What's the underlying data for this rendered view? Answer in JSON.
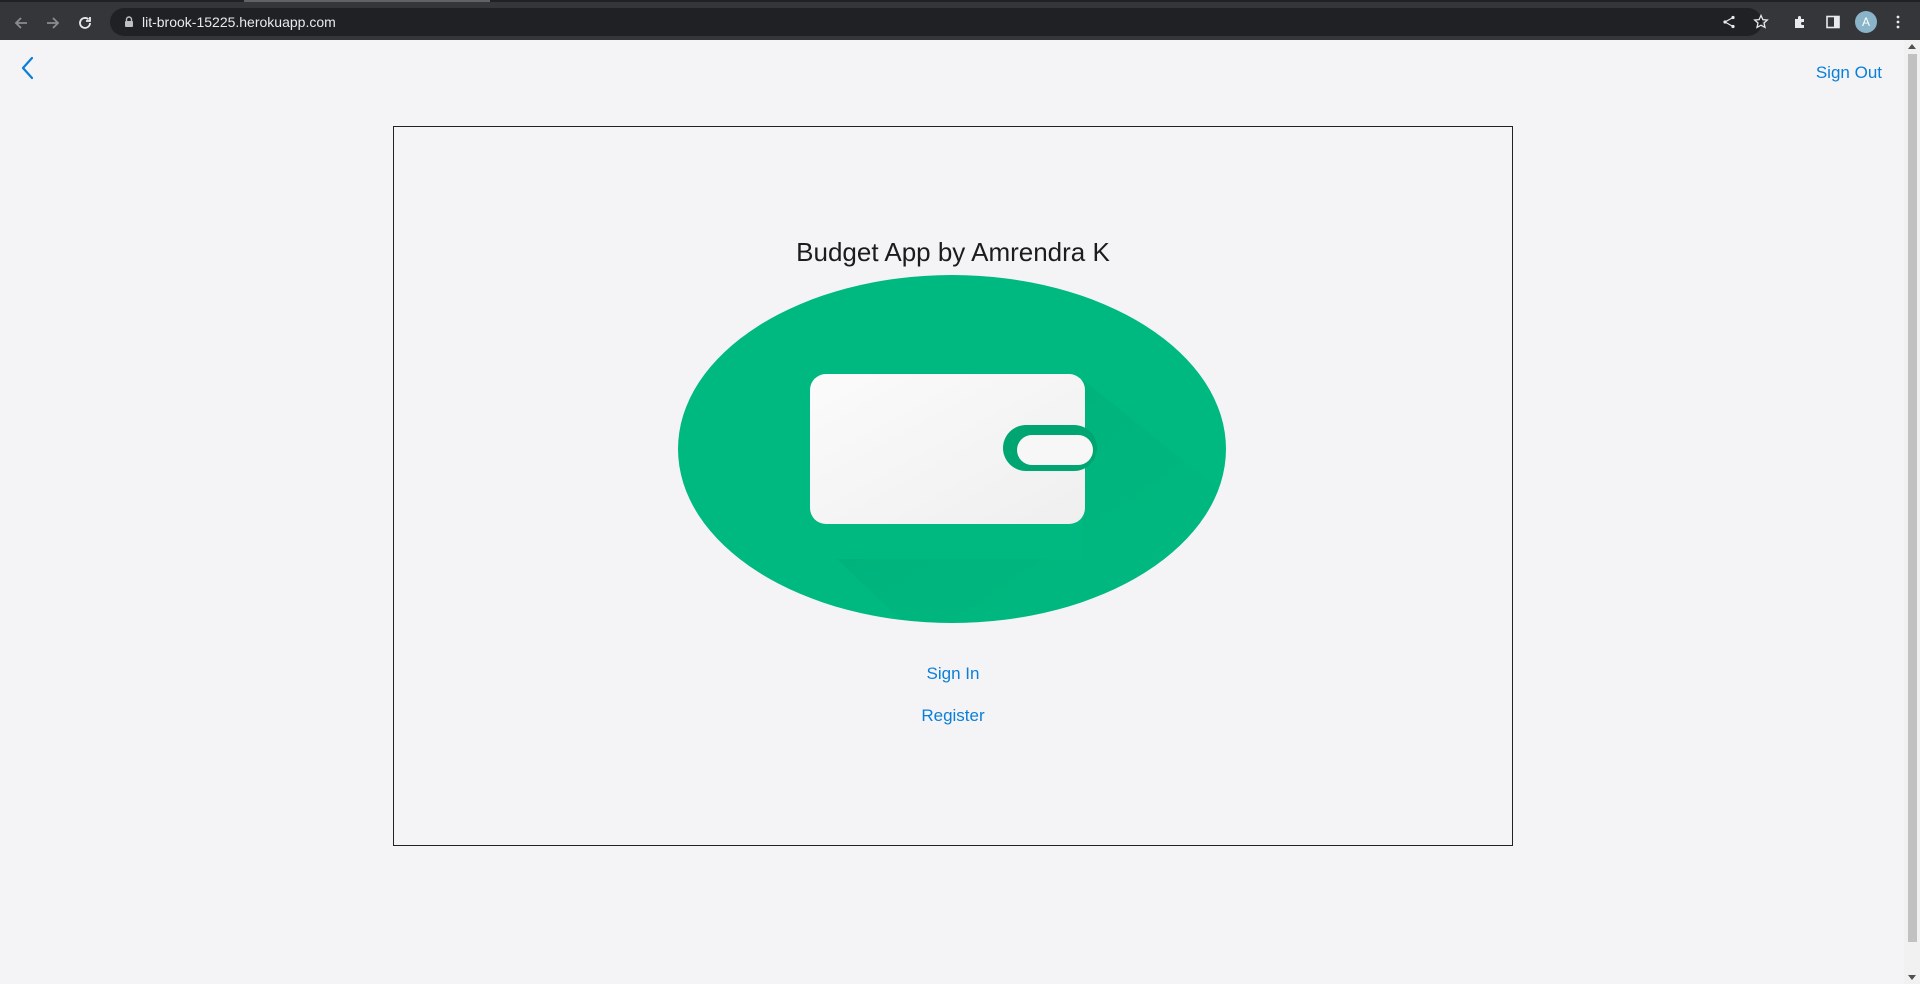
{
  "browser": {
    "url": "lit-brook-15225.herokuapp.com",
    "profile_initial": "A"
  },
  "header": {
    "sign_out_label": "Sign Out"
  },
  "main": {
    "title": "Budget App by Amrendra K",
    "sign_in_label": "Sign In",
    "register_label": "Register"
  },
  "colors": {
    "accent": "#0a7fd8",
    "brand_green": "#00b980"
  },
  "icons": {
    "back": "chevron-left-icon",
    "logo": "wallet-icon"
  }
}
